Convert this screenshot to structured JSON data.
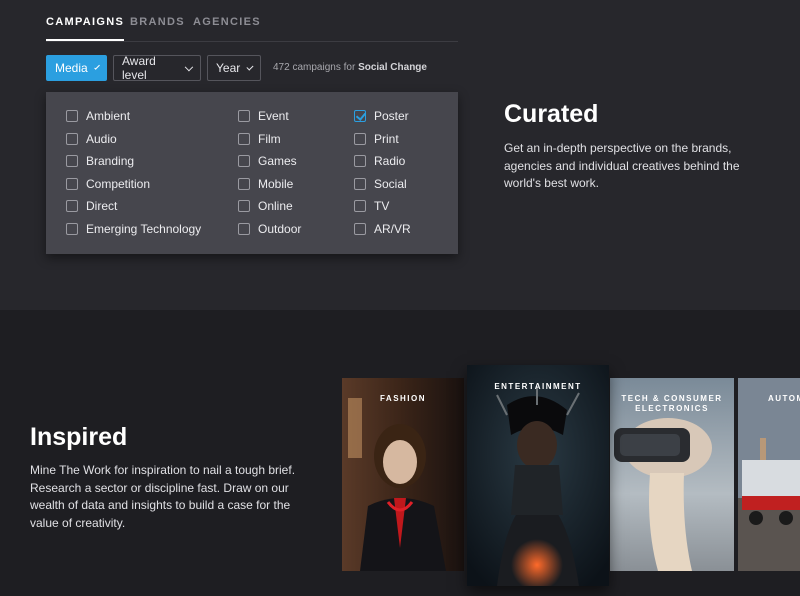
{
  "tabs": [
    {
      "label": "CAMPAIGNS",
      "active": true
    },
    {
      "label": "BRANDS",
      "active": false
    },
    {
      "label": "AGENCIES",
      "active": false
    }
  ],
  "filters": {
    "media": "Media",
    "award_level": "Award level",
    "year": "Year"
  },
  "campaign_count": {
    "prefix": "472 campaigns for",
    "topic": "Social Change"
  },
  "media_options": [
    {
      "label": "Ambient",
      "checked": false
    },
    {
      "label": "Audio",
      "checked": false
    },
    {
      "label": "Branding",
      "checked": false
    },
    {
      "label": "Competition",
      "checked": false
    },
    {
      "label": "Direct",
      "checked": false
    },
    {
      "label": "Emerging Technology",
      "checked": false
    },
    {
      "label": "Event",
      "checked": false
    },
    {
      "label": "Film",
      "checked": false
    },
    {
      "label": "Games",
      "checked": false
    },
    {
      "label": "Mobile",
      "checked": false
    },
    {
      "label": "Online",
      "checked": false
    },
    {
      "label": "Outdoor",
      "checked": false
    },
    {
      "label": "Poster",
      "checked": true
    },
    {
      "label": "Print",
      "checked": false
    },
    {
      "label": "Radio",
      "checked": false
    },
    {
      "label": "Social",
      "checked": false
    },
    {
      "label": "TV",
      "checked": false
    },
    {
      "label": "AR/VR",
      "checked": false
    }
  ],
  "curated": {
    "title": "Curated",
    "body": "Get an in-depth perspective on the brands, agencies and individual creatives behind the world's best work."
  },
  "inspired": {
    "title": "Inspired",
    "body": "Mine The Work for inspiration to nail a tough brief. Research a sector or discipline fast. Draw on our wealth of data and insights to build a case for the value of creativity."
  },
  "cards": [
    {
      "label": "FASHION"
    },
    {
      "label": "ENTERTAINMENT"
    },
    {
      "label": "TECH & CONSUMER ELECTRONICS"
    },
    {
      "label": "AUTOM"
    }
  ],
  "colors": {
    "accent": "#2b9fe0",
    "background_top": "#27272c",
    "background_bottom": "#1e1e22",
    "dropdown": "#46464d"
  }
}
